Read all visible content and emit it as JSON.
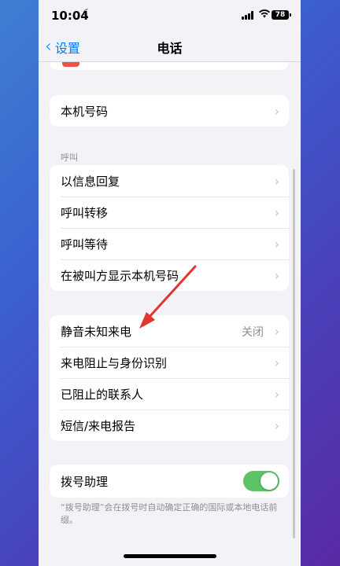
{
  "status_bar": {
    "time": "10:04",
    "battery": "78"
  },
  "nav": {
    "back_label": "设置",
    "title": "电话"
  },
  "groups": {
    "number": [
      {
        "label": "本机号码"
      }
    ],
    "calls_header": "呼叫",
    "calls": [
      {
        "label": "以信息回复"
      },
      {
        "label": "呼叫转移"
      },
      {
        "label": "呼叫等待"
      },
      {
        "label": "在被叫方显示本机号码"
      }
    ],
    "blocking": [
      {
        "label": "静音未知来电",
        "value": "关闭"
      },
      {
        "label": "来电阻止与身份识别"
      },
      {
        "label": "已阻止的联系人"
      },
      {
        "label": "短信/来电报告"
      }
    ],
    "dial_assist": {
      "label": "拨号助理",
      "enabled": true
    },
    "dial_assist_note": "“拨号助理”会在拨号时自动确定正确的国际或本地电话前缀。"
  },
  "colors": {
    "accent": "#007aff",
    "toggle_on": "#5cc366",
    "annotation_arrow": "#e3342f"
  }
}
